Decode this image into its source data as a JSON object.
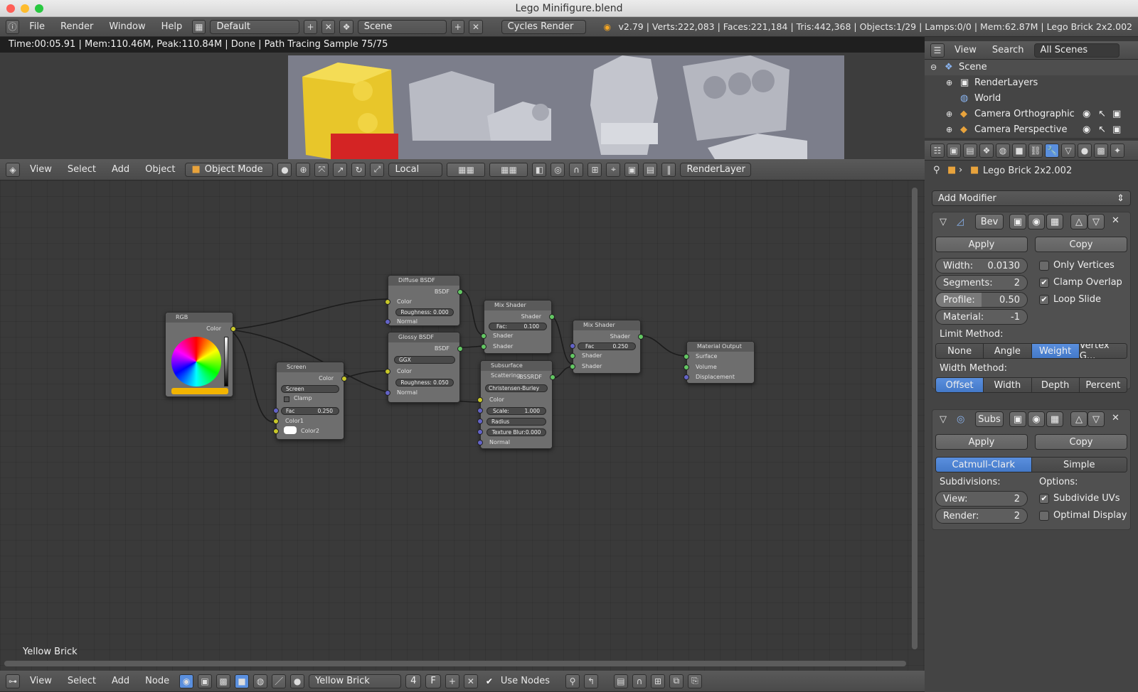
{
  "window": {
    "title": "Lego Minifigure.blend"
  },
  "info": {
    "menus": [
      "File",
      "Render",
      "Window",
      "Help"
    ],
    "layout": "Default",
    "scene": "Scene",
    "engine": "Cycles Render",
    "stats": "v2.79 | Verts:222,083 | Faces:221,184 | Tris:442,368 | Objects:1/29 | Lamps:0/0 | Mem:62.87M | Lego Brick 2x2.002"
  },
  "render_status": "Time:00:05.91 | Mem:110.46M, Peak:110.84M | Done | Path Tracing Sample 75/75",
  "view3d_header": {
    "menus": [
      "View",
      "Select",
      "Add",
      "Object"
    ],
    "mode": "Object Mode",
    "orientation": "Local",
    "render_layer": "RenderLayer"
  },
  "node_editor": {
    "label": "Yellow Brick",
    "nodes": {
      "rgb": {
        "title": "RGB",
        "out": "Color"
      },
      "diffuse": {
        "title": "Diffuse BSDF",
        "out": "BSDF",
        "color": "Color",
        "roughness": "Roughness: 0.000",
        "normal": "Normal"
      },
      "glossy": {
        "title": "Glossy BSDF",
        "out": "BSDF",
        "dist": "GGX",
        "color": "Color",
        "roughness": "Roughness: 0.050",
        "normal": "Normal"
      },
      "screen": {
        "title": "Screen",
        "out": "Color",
        "blend": "Screen",
        "clamp": "Clamp",
        "fac": "Fac",
        "fac_val": "0.250",
        "c1": "Color1",
        "c2": "Color2"
      },
      "mix1": {
        "title": "Mix Shader",
        "out": "Shader",
        "fac": "Fac:",
        "fac_val": "0.100",
        "s1": "Shader",
        "s2": "Shader"
      },
      "sss": {
        "title": "Subsurface Scattering",
        "out": "BSSRDF",
        "method": "Christensen-Burley",
        "color": "Color",
        "scale": "Scale:",
        "scale_val": "1.000",
        "radius": "Radius",
        "blur": "Texture Blur:0.000",
        "normal": "Normal"
      },
      "mix2": {
        "title": "Mix Shader",
        "out": "Shader",
        "fac": "Fac",
        "fac_val": "0.250",
        "s1": "Shader",
        "s2": "Shader"
      },
      "output": {
        "title": "Material Output",
        "surface": "Surface",
        "volume": "Volume",
        "disp": "Displacement"
      }
    }
  },
  "node_footer": {
    "menus": [
      "View",
      "Select",
      "Add",
      "Node"
    ],
    "material": "Yellow Brick",
    "users": "4",
    "fake": "F",
    "use_nodes": "Use Nodes"
  },
  "outliner": {
    "menus": [
      "View",
      "Search"
    ],
    "display": "All Scenes",
    "items": [
      "Scene",
      "RenderLayers",
      "World",
      "Camera Orthographic",
      "Camera Perspective"
    ]
  },
  "properties": {
    "object": "Lego Brick 2x2.002",
    "add_modifier": "Add Modifier",
    "bevel": {
      "name": "Bev",
      "apply": "Apply",
      "copy": "Copy",
      "width_label": "Width:",
      "width": "0.0130",
      "segments_label": "Segments:",
      "segments": "2",
      "profile_label": "Profile:",
      "profile": "0.50",
      "material_label": "Material:",
      "material": "-1",
      "only_vertices": "Only Vertices",
      "clamp_overlap": "Clamp Overlap",
      "loop_slide": "Loop Slide",
      "limit_label": "Limit Method:",
      "limit": [
        "None",
        "Angle",
        "Weight",
        "Vertex G..."
      ],
      "width_method_label": "Width Method:",
      "width_method": [
        "Offset",
        "Width",
        "Depth",
        "Percent"
      ]
    },
    "subsurf": {
      "name": "Subs",
      "apply": "Apply",
      "copy": "Copy",
      "types": [
        "Catmull-Clark",
        "Simple"
      ],
      "subdiv_label": "Subdivisions:",
      "options_label": "Options:",
      "view_label": "View:",
      "view": "2",
      "render_label": "Render:",
      "render": "2",
      "subdivide_uvs": "Subdivide UVs",
      "optimal_display": "Optimal Display"
    }
  },
  "colors": {
    "accent": "#5a8fde",
    "yellow_socket": "#c8c829",
    "green_socket": "#63c763",
    "blue_socket": "#6363c7"
  }
}
